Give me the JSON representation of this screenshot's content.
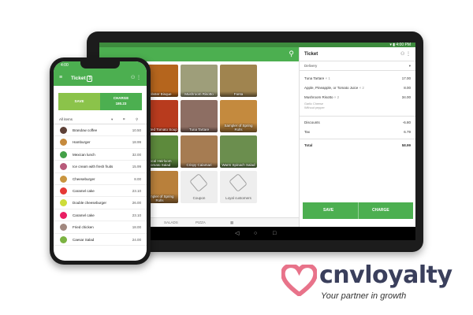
{
  "tablet": {
    "status_time": "▾ ▮ 4:00 PM",
    "tiles": [
      {
        "label": "Fanta",
        "color": "#8a6d3b"
      },
      {
        "label": "Lobster Bisque",
        "color": "#b5651d"
      },
      {
        "label": "Mushroom Risotto",
        "color": "#9e9e7a"
      },
      {
        "label": "Fanta",
        "color": "#a0844f"
      },
      {
        "label": "Roasted Spring Potat...",
        "color": "#7a4a2a"
      },
      {
        "label": "Roasted Tomato Soup",
        "color": "#b83b1e"
      },
      {
        "label": "Tuna Tartare",
        "color": "#8d6e63"
      },
      {
        "label": "Sampler of Spring Rolls",
        "color": "#c48a3e"
      },
      {
        "label": "Shrimp & Pan-Ground C...",
        "color": "#9c5a2c"
      },
      {
        "label": "Local Heirloom Tomato Salad",
        "color": "#5d8a3c"
      },
      {
        "label": "Crispy Calamari",
        "color": "#a67c52"
      },
      {
        "label": "Warm Spinach Salad",
        "color": "#6b8e4e"
      },
      {
        "label": "Desserts",
        "color": "#8bc34a"
      },
      {
        "label": "Sampler of Spring Rolls",
        "color": "#b9803b"
      },
      {
        "label": "Coupon",
        "color": "#eeeeee"
      },
      {
        "label": "Loyal customers",
        "color": "#eeeeee"
      }
    ],
    "categories": [
      "...PTS",
      "FRUITS",
      "SALADS",
      "PIZZA",
      "▦"
    ],
    "nav": [
      "◁",
      "○",
      "□"
    ],
    "ticket": {
      "title": "Ticket",
      "head_icons": "⚇  ⋮",
      "order_type": "Delivery",
      "lines": [
        {
          "name": "Tuna Tartare",
          "qty": "× 1",
          "amount": "17.00"
        },
        {
          "name": "Apple, Pineapple, or Tomato Juice",
          "qty": "× 2",
          "amount": "8.00"
        },
        {
          "name": "Mushroom Risotto",
          "qty": "× 2",
          "amount": "34.00"
        }
      ],
      "modifiers": [
        "Garlic Cheese",
        "Without pepper"
      ],
      "discounts_label": "Discounts",
      "discounts_value": "-6.80",
      "tax_label": "Tax",
      "tax_value": "6.79",
      "total_label": "Total",
      "total_value": "58.99",
      "save_label": "SAVE",
      "charge_label": "CHARGE"
    }
  },
  "phone": {
    "status_time": "4:00",
    "title": "Ticket",
    "badge": "3",
    "save_label": "SAVE",
    "charge_label": "CHARGE",
    "charge_amount": "180.23",
    "filter_label": "All items",
    "items": [
      {
        "name": "Brandow coffee",
        "price": "10.50",
        "color": "#5d4037"
      },
      {
        "name": "Hamburger",
        "price": "18.99",
        "color": "#c58a3d"
      },
      {
        "name": "Mexican lunch",
        "price": "32.00",
        "color": "#43a047"
      },
      {
        "name": "Ice cream with fresh fruits",
        "price": "15.99",
        "color": "#b85a7a"
      },
      {
        "name": "Cheeseburger",
        "price": "8.00",
        "color": "#c9953f"
      },
      {
        "name": "Caramel cake",
        "price": "23.10",
        "color": "#e53935"
      },
      {
        "name": "Double cheeseburger",
        "price": "26.00",
        "color": "#cddc39"
      },
      {
        "name": "Caramel cake",
        "price": "23.10",
        "color": "#e91e63"
      },
      {
        "name": "Fried chicken",
        "price": "18.00",
        "color": "#a1887f"
      },
      {
        "name": "Caesar Salad",
        "price": "24.00",
        "color": "#7cb342"
      }
    ]
  },
  "logo": {
    "brand": "cnvloyalty",
    "tagline": "Your partner in growth",
    "heart_color": "#e8738a"
  }
}
